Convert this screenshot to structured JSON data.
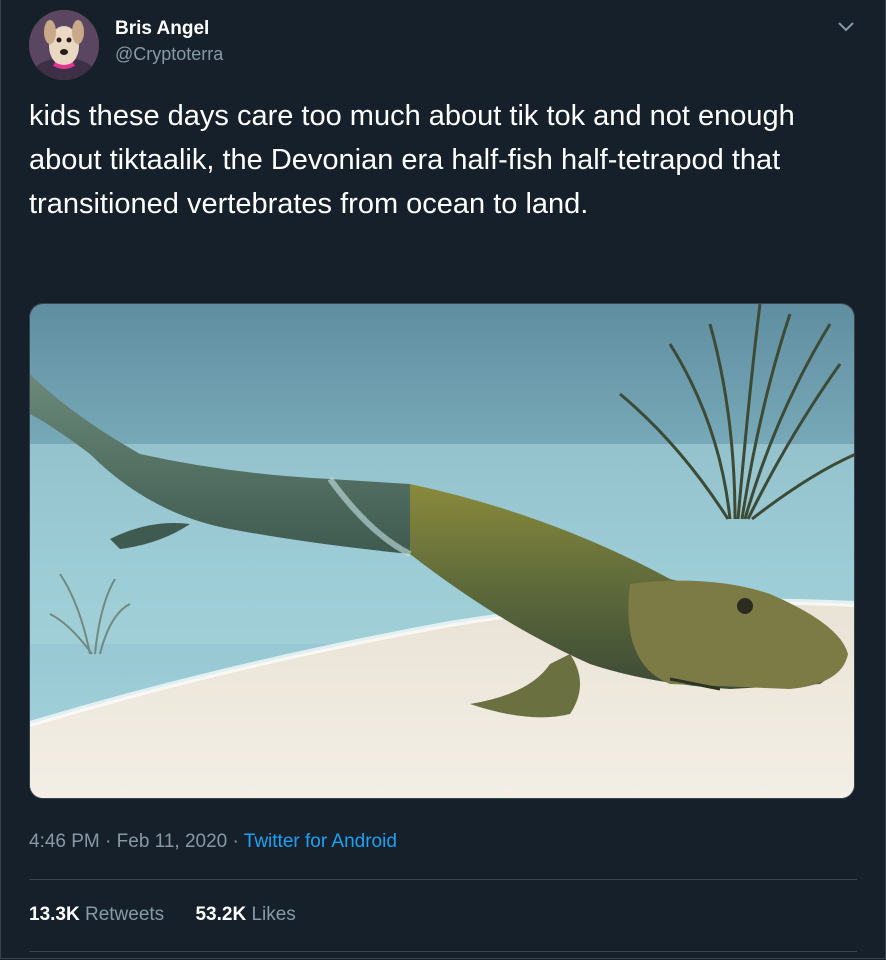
{
  "tweet": {
    "author": {
      "display_name": "Bris Angel",
      "handle": "@Cryptoterra",
      "avatar_icon": "dog-avatar"
    },
    "text": "kids these days care too much about tik tok and not enough about tiktaalik, the Devonian era half-fish half-tetrapod that transitioned vertebrates from ocean to land.",
    "image_description_icon": "tiktaalik-illustration",
    "time": "4:46 PM",
    "separator": "·",
    "date": "Feb 11, 2020",
    "source": "Twitter for Android",
    "stats": {
      "retweets_count": "13.3K",
      "retweets_label": "Retweets",
      "likes_count": "53.2K",
      "likes_label": "Likes"
    }
  },
  "colors": {
    "background": "#15202b",
    "border": "#38444d",
    "secondary_text": "#8899a6",
    "link": "#1da1f2"
  }
}
